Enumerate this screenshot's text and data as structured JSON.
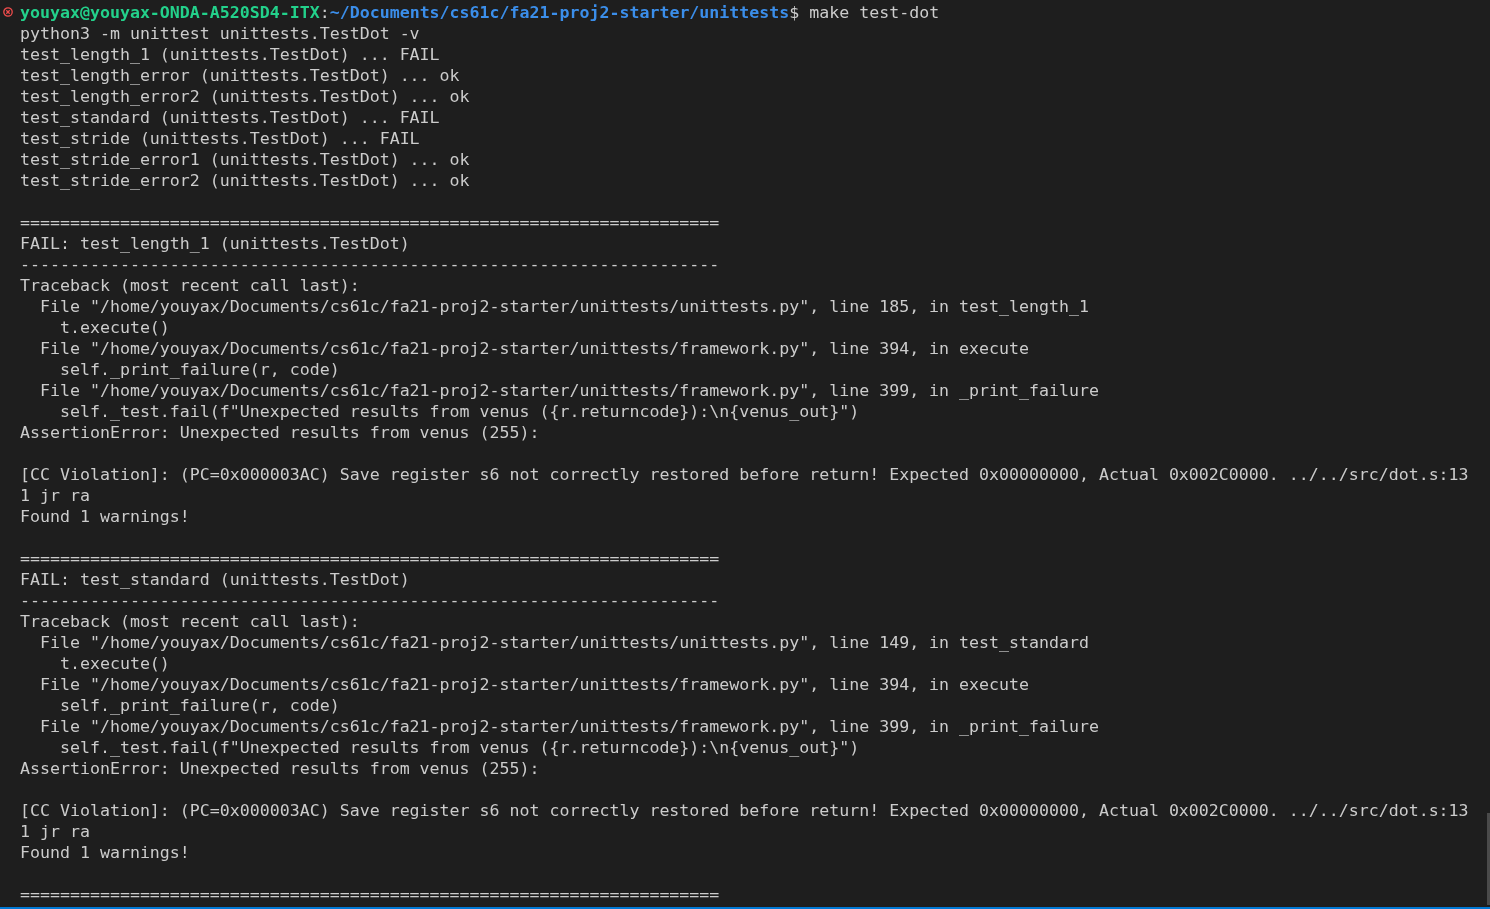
{
  "terminal": {
    "prompt": {
      "failed": true,
      "user_host": "youyax@youyax-ONDA-A520SD4-ITX",
      "separator": ":",
      "path": "~/Documents/cs61c/fa21-proj2-starter/unittests",
      "symbol": "$",
      "command": " make test-dot"
    },
    "blocks": [
      {
        "lines": [
          "python3 -m unittest unittests.TestDot -v",
          "test_length_1 (unittests.TestDot) ... FAIL",
          "test_length_error (unittests.TestDot) ... ok",
          "test_length_error2 (unittests.TestDot) ... ok",
          "test_standard (unittests.TestDot) ... FAIL",
          "test_stride (unittests.TestDot) ... FAIL",
          "test_stride_error1 (unittests.TestDot) ... ok",
          "test_stride_error2 (unittests.TestDot) ... ok"
        ]
      },
      {
        "lines": [
          "======================================================================",
          "FAIL: test_length_1 (unittests.TestDot)",
          "----------------------------------------------------------------------",
          "Traceback (most recent call last):",
          "  File \"/home/youyax/Documents/cs61c/fa21-proj2-starter/unittests/unittests.py\", line 185, in test_length_1",
          "    t.execute()",
          "  File \"/home/youyax/Documents/cs61c/fa21-proj2-starter/unittests/framework.py\", line 394, in execute",
          "    self._print_failure(r, code)",
          "  File \"/home/youyax/Documents/cs61c/fa21-proj2-starter/unittests/framework.py\", line 399, in _print_failure",
          "    self._test.fail(f\"Unexpected results from venus ({r.returncode}):\\n{venus_out}\")",
          "AssertionError: Unexpected results from venus (255):"
        ]
      },
      {
        "lines": [
          "[CC Violation]: (PC=0x000003AC) Save register s6 not correctly restored before return! Expected 0x00000000, Actual 0x002C0000. ../../src/dot.s:13",
          "1 jr ra",
          "Found 1 warnings!"
        ]
      },
      {
        "lines": [
          "======================================================================",
          "FAIL: test_standard (unittests.TestDot)",
          "----------------------------------------------------------------------",
          "Traceback (most recent call last):",
          "  File \"/home/youyax/Documents/cs61c/fa21-proj2-starter/unittests/unittests.py\", line 149, in test_standard",
          "    t.execute()",
          "  File \"/home/youyax/Documents/cs61c/fa21-proj2-starter/unittests/framework.py\", line 394, in execute",
          "    self._print_failure(r, code)",
          "  File \"/home/youyax/Documents/cs61c/fa21-proj2-starter/unittests/framework.py\", line 399, in _print_failure",
          "    self._test.fail(f\"Unexpected results from venus ({r.returncode}):\\n{venus_out}\")",
          "AssertionError: Unexpected results from venus (255):"
        ]
      },
      {
        "lines": [
          "[CC Violation]: (PC=0x000003AC) Save register s6 not correctly restored before return! Expected 0x00000000, Actual 0x002C0000. ../../src/dot.s:13",
          "1 jr ra",
          "Found 1 warnings!"
        ]
      },
      {
        "lines": [
          "======================================================================"
        ]
      }
    ]
  }
}
